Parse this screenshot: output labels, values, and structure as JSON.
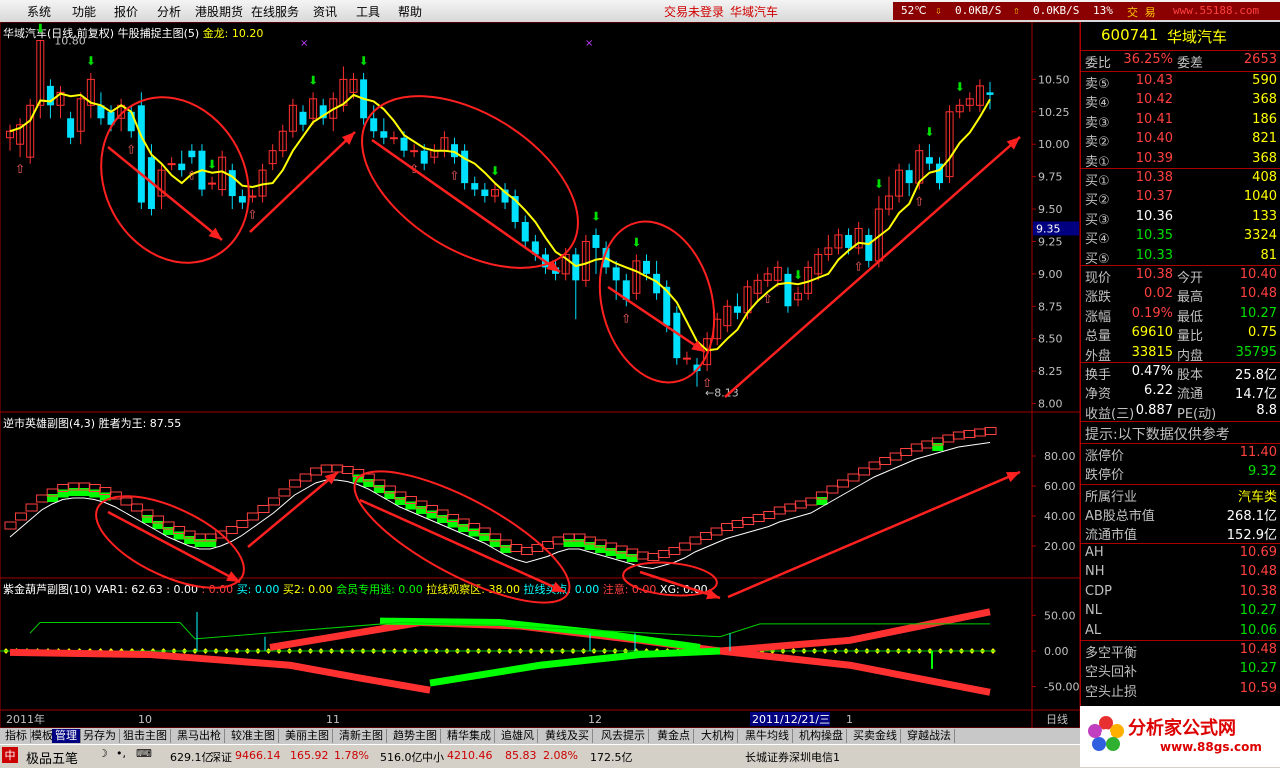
{
  "menu": [
    "系统",
    "功能",
    "报价",
    "分析",
    "港股期货",
    "在线服务",
    "资讯",
    "工具",
    "帮助"
  ],
  "menu_x": [
    27,
    72,
    114,
    157,
    195,
    251,
    313,
    356,
    398
  ],
  "top_warn": "交易未登录",
  "top_stock": "华域汽车",
  "top_status": {
    "temp": "52℃",
    "down_speed": "0.0KB/S",
    "up_speed": "0.0KB/S",
    "cpu": "13%",
    "trade": "交 易",
    "site": "www.55188.com"
  },
  "main_title": {
    "stock": "华域汽车(日线,前复权)",
    "indicator": "牛股捕捉主图(5)",
    "label": "金龙:",
    "value": "10.20"
  },
  "main_axis": [
    "10.50",
    "10.25",
    "10.00",
    "9.75",
    "9.50",
    "9.25",
    "9.00",
    "8.75",
    "8.50",
    "8.25",
    "8.00"
  ],
  "main_axis_v": [
    10.5,
    10.25,
    10.0,
    9.75,
    9.5,
    9.25,
    9.0,
    8.75,
    8.5,
    8.25,
    8.0
  ],
  "price_highlight": "9.35",
  "label_high": "10.80",
  "label_low": "8.13",
  "sub1_title": {
    "name": "逆市英雄副图(4,3)",
    "label": "胜者为王:",
    "value": "87.55"
  },
  "sub1_axis": [
    "80.00",
    "60.00",
    "40.00",
    "20.00"
  ],
  "sub2_title": {
    "name": "紫金葫芦副图(10)",
    "var1": "VAR1: 62.63",
    "a": ": 0.00",
    "b": ": 0.00",
    "buy": "买: 0.00",
    "buy2": "买2: 0.00",
    "member": "会员专用逃: 0.00",
    "zone": "拉线观察区: 38.00",
    "point": "拉线买点: 0.00",
    "note": "注意: 0.00",
    "xg": "XG: 0.00"
  },
  "sub2_axis": [
    "50.00",
    "0.00",
    "-50.00"
  ],
  "time_axis": {
    "year": "2011年",
    "m10": "10",
    "m11": "11",
    "m12": "12",
    "m1": "1",
    "cursor": "2011/12/21/三",
    "period": "日线"
  },
  "quote": {
    "code": "600741",
    "name": "华域汽车",
    "wb_label": "委比",
    "wb": "36.25%",
    "wc_label": "委差",
    "wc": "2653",
    "asks": [
      {
        "l": "卖⑤",
        "p": "10.43",
        "v": "590"
      },
      {
        "l": "卖④",
        "p": "10.42",
        "v": "368"
      },
      {
        "l": "卖③",
        "p": "10.41",
        "v": "186"
      },
      {
        "l": "卖②",
        "p": "10.40",
        "v": "821"
      },
      {
        "l": "卖①",
        "p": "10.39",
        "v": "368"
      }
    ],
    "bids": [
      {
        "l": "买①",
        "p": "10.38",
        "v": "408"
      },
      {
        "l": "买②",
        "p": "10.37",
        "v": "1040"
      },
      {
        "l": "买③",
        "p": "10.36",
        "v": "133"
      },
      {
        "l": "买④",
        "p": "10.35",
        "v": "3324"
      },
      {
        "l": "买⑤",
        "p": "10.33",
        "v": "81"
      }
    ],
    "stats": [
      {
        "l": "现价",
        "v": "10.38",
        "l2": "今开",
        "v2": "10.40"
      },
      {
        "l": "涨跌",
        "v": "0.02",
        "l2": "最高",
        "v2": "10.48"
      },
      {
        "l": "涨幅",
        "v": "0.19%",
        "l2": "最低",
        "v2": "10.27"
      },
      {
        "l": "总量",
        "v": "69610",
        "l2": "量比",
        "v2": "0.75"
      },
      {
        "l": "外盘",
        "v": "33815",
        "l2": "内盘",
        "v2": "35795"
      }
    ],
    "fin": [
      {
        "l": "换手",
        "v": "0.47%",
        "l2": "股本",
        "v2": "25.8亿"
      },
      {
        "l": "净资",
        "v": "6.22",
        "l2": "流通",
        "v2": "14.7亿"
      },
      {
        "l": "收益(三)",
        "v": "0.887",
        "l2": "PE(动)",
        "v2": "8.8"
      }
    ],
    "tip": "提示:以下数据仅供参考",
    "limit_up_l": "涨停价",
    "limit_up": "11.40",
    "limit_dn_l": "跌停价",
    "limit_dn": "9.32",
    "industry_l": "所属行业",
    "industry": "汽车类",
    "ab_l": "AB股总市值",
    "ab": "268.1亿",
    "float_l": "流通市值",
    "float": "152.9亿",
    "levels": [
      {
        "l": "AH",
        "v": "10.69"
      },
      {
        "l": "NH",
        "v": "10.48"
      },
      {
        "l": "CDP",
        "v": "10.38"
      },
      {
        "l": "NL",
        "v": "10.27"
      },
      {
        "l": "AL",
        "v": "10.06"
      }
    ],
    "balance": [
      {
        "l": "多空平衡",
        "v": "10.48"
      },
      {
        "l": "空头回补",
        "v": "10.27"
      },
      {
        "l": "空头止损",
        "v": "10.59"
      }
    ]
  },
  "tabs": [
    "指标",
    "模板",
    "管理",
    "另存为",
    "狙击主图",
    "黑马出枪",
    "较准主图",
    "美丽主图",
    "清新主图",
    "趋势主图",
    "精华集成",
    "追雄风",
    "黄线及买",
    "风去提示",
    "黄金点",
    "大机构",
    "黑牛均线",
    "机构操盘",
    "买卖金线",
    "穿越战法"
  ],
  "status": {
    "brand": "极品五笔",
    "amt1": "629.1亿",
    "sz_l": "深证",
    "sz": "9466.14",
    "sz_chg": "165.92",
    "sz_pct": "1.78%",
    "amt2": "516.0亿",
    "zx_l": "中小",
    "zx": "4210.46",
    "zx_chg": "85.83",
    "zx_pct": "2.08%",
    "amt3": "172.5亿",
    "broker": "长城证券深圳电信1"
  },
  "logo": {
    "title": "分析家公式网",
    "url": "www.88gs.com"
  },
  "colors": {
    "up": "#ff3030",
    "down": "#00e0ff",
    "ma": "#ffff00",
    "annot": "#ff2020",
    "green": "#00ff00"
  },
  "chart_data": {
    "type": "candlestick",
    "title": "华域汽车(日线,前复权)",
    "ylim": [
      7.95,
      10.85
    ],
    "x_ticks": [
      "2011年",
      "10",
      "11",
      "12",
      "1"
    ],
    "candles": [
      [
        10.05,
        10.1,
        9.95,
        10.15
      ],
      [
        10.0,
        10.15,
        9.9,
        10.2
      ],
      [
        9.9,
        10.3,
        9.85,
        10.35
      ],
      [
        10.3,
        10.8,
        10.2,
        10.8
      ],
      [
        10.45,
        10.3,
        10.2,
        10.5
      ],
      [
        10.3,
        10.4,
        10.2,
        10.45
      ],
      [
        10.2,
        10.05,
        10.0,
        10.25
      ],
      [
        10.1,
        10.35,
        10.0,
        10.4
      ],
      [
        10.3,
        10.5,
        10.2,
        10.55
      ],
      [
        10.3,
        10.2,
        10.15,
        10.4
      ],
      [
        10.25,
        10.15,
        10.1,
        10.3
      ],
      [
        10.2,
        10.3,
        10.1,
        10.35
      ],
      [
        10.25,
        10.1,
        10.05,
        10.3
      ],
      [
        10.3,
        9.55,
        9.5,
        10.4
      ],
      [
        9.9,
        9.5,
        9.45,
        10.0
      ],
      [
        9.6,
        9.8,
        9.5,
        9.85
      ],
      [
        9.85,
        9.85,
        9.8,
        9.9
      ],
      [
        9.85,
        9.8,
        9.75,
        9.95
      ],
      [
        9.95,
        9.9,
        9.85,
        10.0
      ],
      [
        9.95,
        9.65,
        9.6,
        10.0
      ],
      [
        9.7,
        9.7,
        9.65,
        9.75
      ],
      [
        9.65,
        9.9,
        9.6,
        9.95
      ],
      [
        9.8,
        9.6,
        9.5,
        9.85
      ],
      [
        9.6,
        9.55,
        9.5,
        9.65
      ],
      [
        9.6,
        9.6,
        9.55,
        9.65
      ],
      [
        9.6,
        9.8,
        9.55,
        9.85
      ],
      [
        9.85,
        9.95,
        9.8,
        10.0
      ],
      [
        9.95,
        10.1,
        9.9,
        10.15
      ],
      [
        10.1,
        10.3,
        10.05,
        10.35
      ],
      [
        10.25,
        10.15,
        10.1,
        10.3
      ],
      [
        10.2,
        10.35,
        10.15,
        10.4
      ],
      [
        10.3,
        10.2,
        10.15,
        10.35
      ],
      [
        10.2,
        10.35,
        10.1,
        10.4
      ],
      [
        10.3,
        10.5,
        10.25,
        10.6
      ],
      [
        10.4,
        10.5,
        10.35,
        10.55
      ],
      [
        10.5,
        10.2,
        10.15,
        10.55
      ],
      [
        10.2,
        10.1,
        10.05,
        10.3
      ],
      [
        10.1,
        10.05,
        10.0,
        10.2
      ],
      [
        10.05,
        10.05,
        10.0,
        10.1
      ],
      [
        10.05,
        9.95,
        9.9,
        10.1
      ],
      [
        9.95,
        9.95,
        9.9,
        10.0
      ],
      [
        9.95,
        9.85,
        9.8,
        10.0
      ],
      [
        9.9,
        9.95,
        9.85,
        10.0
      ],
      [
        9.95,
        10.05,
        9.9,
        10.1
      ],
      [
        10.0,
        9.9,
        9.85,
        10.05
      ],
      [
        9.95,
        9.7,
        9.65,
        10.0
      ],
      [
        9.7,
        9.65,
        9.6,
        9.75
      ],
      [
        9.65,
        9.6,
        9.55,
        9.7
      ],
      [
        9.6,
        9.65,
        9.55,
        9.7
      ],
      [
        9.65,
        9.55,
        9.5,
        9.7
      ],
      [
        9.6,
        9.4,
        9.35,
        9.65
      ],
      [
        9.4,
        9.25,
        9.2,
        9.45
      ],
      [
        9.25,
        9.15,
        9.1,
        9.3
      ],
      [
        9.15,
        9.05,
        9.0,
        9.2
      ],
      [
        9.05,
        9.0,
        8.95,
        9.1
      ],
      [
        9.0,
        9.15,
        8.95,
        9.2
      ],
      [
        9.15,
        8.95,
        8.65,
        9.2
      ],
      [
        8.95,
        9.25,
        8.9,
        9.3
      ],
      [
        9.3,
        9.2,
        9.0,
        9.35
      ],
      [
        9.2,
        9.05,
        9.0,
        9.25
      ],
      [
        9.05,
        8.95,
        8.8,
        9.1
      ],
      [
        8.95,
        8.8,
        8.75,
        9.0
      ],
      [
        8.85,
        9.1,
        8.8,
        9.15
      ],
      [
        9.1,
        9.0,
        8.95,
        9.15
      ],
      [
        9.0,
        8.85,
        8.8,
        9.1
      ],
      [
        8.9,
        8.6,
        8.55,
        8.95
      ],
      [
        8.7,
        8.35,
        8.3,
        8.75
      ],
      [
        8.35,
        8.35,
        8.3,
        8.4
      ],
      [
        8.3,
        8.25,
        8.13,
        8.35
      ],
      [
        8.3,
        8.5,
        8.25,
        8.55
      ],
      [
        8.5,
        8.65,
        8.45,
        8.7
      ],
      [
        8.6,
        8.75,
        8.55,
        8.8
      ],
      [
        8.75,
        8.7,
        8.65,
        8.85
      ],
      [
        8.7,
        8.9,
        8.65,
        8.95
      ],
      [
        8.85,
        8.95,
        8.8,
        9.0
      ],
      [
        8.95,
        9.0,
        8.9,
        9.05
      ],
      [
        8.95,
        9.05,
        8.9,
        9.1
      ],
      [
        9.0,
        8.75,
        8.7,
        9.05
      ],
      [
        8.8,
        8.85,
        8.75,
        8.9
      ],
      [
        8.85,
        9.05,
        8.8,
        9.1
      ],
      [
        9.0,
        9.15,
        8.95,
        9.2
      ],
      [
        9.15,
        9.2,
        9.1,
        9.3
      ],
      [
        9.2,
        9.3,
        9.15,
        9.35
      ],
      [
        9.3,
        9.2,
        9.15,
        9.35
      ],
      [
        9.2,
        9.35,
        9.15,
        9.4
      ],
      [
        9.3,
        9.1,
        9.05,
        9.35
      ],
      [
        9.1,
        9.5,
        9.05,
        9.6
      ],
      [
        9.5,
        9.6,
        9.45,
        9.75
      ],
      [
        9.6,
        9.8,
        9.55,
        9.85
      ],
      [
        9.8,
        9.7,
        9.6,
        9.85
      ],
      [
        9.7,
        9.95,
        9.65,
        10.0
      ],
      [
        9.9,
        9.85,
        9.8,
        10.0
      ],
      [
        9.85,
        9.7,
        9.65,
        9.9
      ],
      [
        9.75,
        10.25,
        9.7,
        10.3
      ],
      [
        10.25,
        10.3,
        10.2,
        10.35
      ],
      [
        10.3,
        10.35,
        10.25,
        10.4
      ],
      [
        10.3,
        10.45,
        10.25,
        10.5
      ],
      [
        10.4,
        10.38,
        10.27,
        10.48
      ]
    ]
  }
}
